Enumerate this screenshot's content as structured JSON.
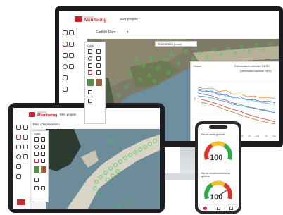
{
  "app": {
    "brand": "Monitoring",
    "brand_prefix": "SOLDATA"
  },
  "monitor": {
    "nav_projects": "Mes projets",
    "project_select": "Earthlili Dam",
    "tools_title": "Outils",
    "layer_select": "SOL/GRIDS (none)",
    "chart": {
      "header_left": "Heure",
      "header_right": "Déformation cumulée DESC",
      "title": "Déformation cumulée DESC",
      "ylabel": "Déf",
      "x_tick_labels": [
        "juil.",
        "sept.",
        "nov.",
        "janv.",
        "mars",
        "mai",
        "juil.",
        "sept.",
        "nov.",
        "janv."
      ]
    }
  },
  "tablet": {
    "nav_projects": "Mes projets",
    "plan_select": "Plan d'implantation",
    "tools_title": "Outils"
  },
  "phone": {
    "gauge1_label": "Etat de santé general",
    "gauge1_value": "100",
    "gauge2_label": "Etat de fonctionnement du système",
    "gauge2_value": "100"
  },
  "colors": {
    "brand_red": "#c8262c",
    "gauge_green": "#2eaa4a",
    "gauge_yellow": "#f2c12e",
    "gauge_red": "#d9342b"
  }
}
